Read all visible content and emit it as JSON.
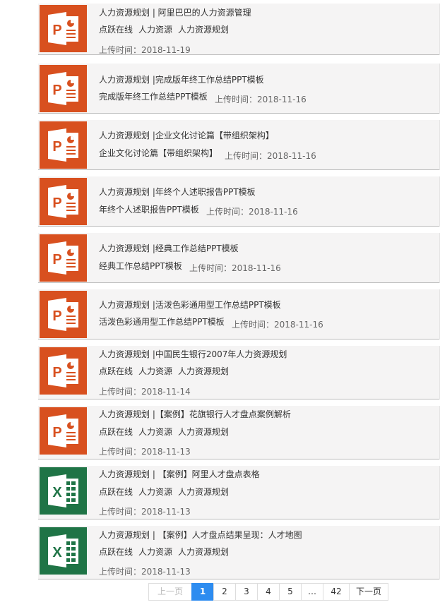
{
  "items": [
    {
      "type": "ppt",
      "icon": "powerpoint-file-icon",
      "title": "人力资源规划 | 阿里巴巴的人力资源管理",
      "tags": [
        "点跃在线",
        "人力资源",
        "人力资源规划"
      ],
      "desc": "",
      "date_label": "上传时间：",
      "date": "2018-11-19"
    },
    {
      "type": "ppt",
      "icon": "powerpoint-file-icon",
      "title": "人力资源规划 |完成版年终工作总结PPT模板",
      "tags": [],
      "desc": "完成版年终工作总结PPT模板",
      "date_label": "上传时间：",
      "date": "2018-11-16"
    },
    {
      "type": "ppt",
      "icon": "powerpoint-file-icon",
      "title": "人力资源规划 |企业文化讨论篇【带组织架构】",
      "tags": [],
      "desc": "企业文化讨论篇【带组织架构】",
      "date_label": "上传时间：",
      "date": "2018-11-16"
    },
    {
      "type": "ppt",
      "icon": "powerpoint-file-icon",
      "title": "人力资源规划 |年终个人述职报告PPT模板",
      "tags": [],
      "desc": "年终个人述职报告PPT模板",
      "date_label": "上传时间：",
      "date": "2018-11-16"
    },
    {
      "type": "ppt",
      "icon": "powerpoint-file-icon",
      "title": "人力资源规划 |经典工作总结PPT模板",
      "tags": [],
      "desc": "经典工作总结PPT模板",
      "date_label": "上传时间：",
      "date": "2018-11-16"
    },
    {
      "type": "ppt",
      "icon": "powerpoint-file-icon",
      "title": "人力资源规划 |活泼色彩通用型工作总结PPT模板",
      "tags": [],
      "desc": "活泼色彩通用型工作总结PPT模板",
      "date_label": "上传时间：",
      "date": "2018-11-16"
    },
    {
      "type": "ppt",
      "icon": "powerpoint-file-icon",
      "title": "人力资源规划 |中国民生银行2007年人力资源规划",
      "tags": [
        "点跃在线",
        "人力资源",
        "人力资源规划"
      ],
      "desc": "",
      "date_label": "上传时间：",
      "date": "2018-11-14"
    },
    {
      "type": "ppt",
      "icon": "powerpoint-file-icon",
      "title": "人力资源规划 |【案例】花旗银行人才盘点案例解析",
      "tags": [
        "点跃在线",
        "人力资源",
        "人力资源规划"
      ],
      "desc": "",
      "date_label": "上传时间：",
      "date": "2018-11-13"
    },
    {
      "type": "xls",
      "icon": "excel-file-icon",
      "title": "人力资源规划 | 【案例】阿里人才盘点表格",
      "tags": [
        "点跃在线",
        "人力资源",
        "人力资源规划"
      ],
      "desc": "",
      "date_label": "上传时间：",
      "date": "2018-11-13"
    },
    {
      "type": "xls",
      "icon": "excel-file-icon",
      "title": "人力资源规划 | 【案例】人才盘点结果呈现：人才地图",
      "tags": [
        "点跃在线",
        "人力资源",
        "人力资源规划"
      ],
      "desc": "",
      "date_label": "上传时间：",
      "date": "2018-11-13"
    }
  ],
  "pagination": {
    "prev": "上一页",
    "pages": [
      "1",
      "2",
      "3",
      "4",
      "5",
      "…",
      "42"
    ],
    "current": "1",
    "next": "下一页"
  },
  "colors": {
    "ppt": "#d8501f",
    "xls": "#1f7446",
    "active_page": "#2d8cf0"
  }
}
